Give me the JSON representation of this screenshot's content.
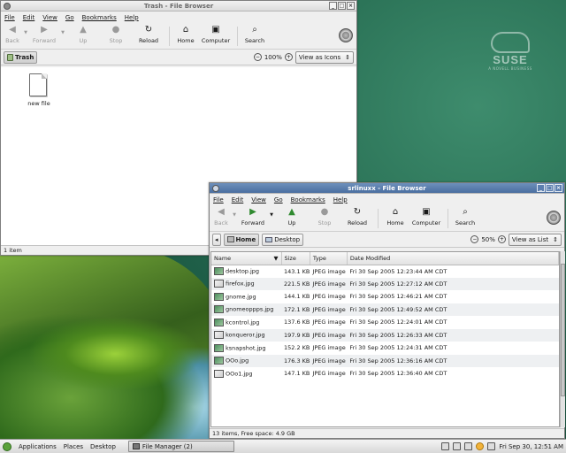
{
  "desktop": {
    "brand_text": "SUSE",
    "brand_subtext": "A NOVELL BUSINESS"
  },
  "trash_window": {
    "title": "Trash - File Browser",
    "menu": [
      "File",
      "Edit",
      "View",
      "Go",
      "Bookmarks",
      "Help"
    ],
    "toolbar": {
      "back": "Back",
      "forward": "Forward",
      "up": "Up",
      "stop": "Stop",
      "reload": "Reload",
      "home": "Home",
      "computer": "Computer",
      "search": "Search"
    },
    "location": "Trash",
    "zoom": "100%",
    "view_mode": "View as Icons",
    "files": [
      {
        "name": "new file"
      }
    ],
    "status": "1 item"
  },
  "browser_window": {
    "title": "srlinuxx - File Browser",
    "menu": [
      "File",
      "Edit",
      "View",
      "Go",
      "Bookmarks",
      "Help"
    ],
    "toolbar": {
      "back": "Back",
      "forward": "Forward",
      "up": "Up",
      "stop": "Stop",
      "reload": "Reload",
      "home": "Home",
      "computer": "Computer",
      "search": "Search"
    },
    "path": [
      "Home",
      "Desktop"
    ],
    "zoom": "50%",
    "view_mode": "View as List",
    "columns": [
      "Name",
      "Size",
      "Type",
      "Date Modified"
    ],
    "rows": [
      {
        "name": "desktop.jpg",
        "size": "143.1 KB",
        "type": "JPEG image",
        "date": "Fri 30 Sep 2005 12:23:44 AM CDT",
        "thumb": "green"
      },
      {
        "name": "firefox.jpg",
        "size": "221.5 KB",
        "type": "JPEG image",
        "date": "Fri 30 Sep 2005 12:27:12 AM CDT",
        "thumb": "white"
      },
      {
        "name": "gnome.jpg",
        "size": "144.1 KB",
        "type": "JPEG image",
        "date": "Fri 30 Sep 2005 12:46:21 AM CDT",
        "thumb": "green"
      },
      {
        "name": "gnomeoppps.jpg",
        "size": "172.1 KB",
        "type": "JPEG image",
        "date": "Fri 30 Sep 2005 12:49:52 AM CDT",
        "thumb": "green"
      },
      {
        "name": "kcontrol.jpg",
        "size": "137.6 KB",
        "type": "JPEG image",
        "date": "Fri 30 Sep 2005 12:24:01 AM CDT",
        "thumb": "green"
      },
      {
        "name": "konqueror.jpg",
        "size": "197.9 KB",
        "type": "JPEG image",
        "date": "Fri 30 Sep 2005 12:26:33 AM CDT",
        "thumb": "white"
      },
      {
        "name": "ksnapshot.jpg",
        "size": "152.2 KB",
        "type": "JPEG image",
        "date": "Fri 30 Sep 2005 12:24:31 AM CDT",
        "thumb": "green"
      },
      {
        "name": "OOo.jpg",
        "size": "176.3 KB",
        "type": "JPEG image",
        "date": "Fri 30 Sep 2005 12:36:16 AM CDT",
        "thumb": "green"
      },
      {
        "name": "OOo1.jpg",
        "size": "147.1 KB",
        "type": "JPEG image",
        "date": "Fri 30 Sep 2005 12:36:40 AM CDT",
        "thumb": "white"
      }
    ],
    "status": "13 items, Free space: 4.9 GB"
  },
  "panel": {
    "menus": [
      "Applications",
      "Places",
      "Desktop"
    ],
    "task": "File Manager (2)",
    "clock": "Fri Sep 30, 12:51 AM"
  }
}
